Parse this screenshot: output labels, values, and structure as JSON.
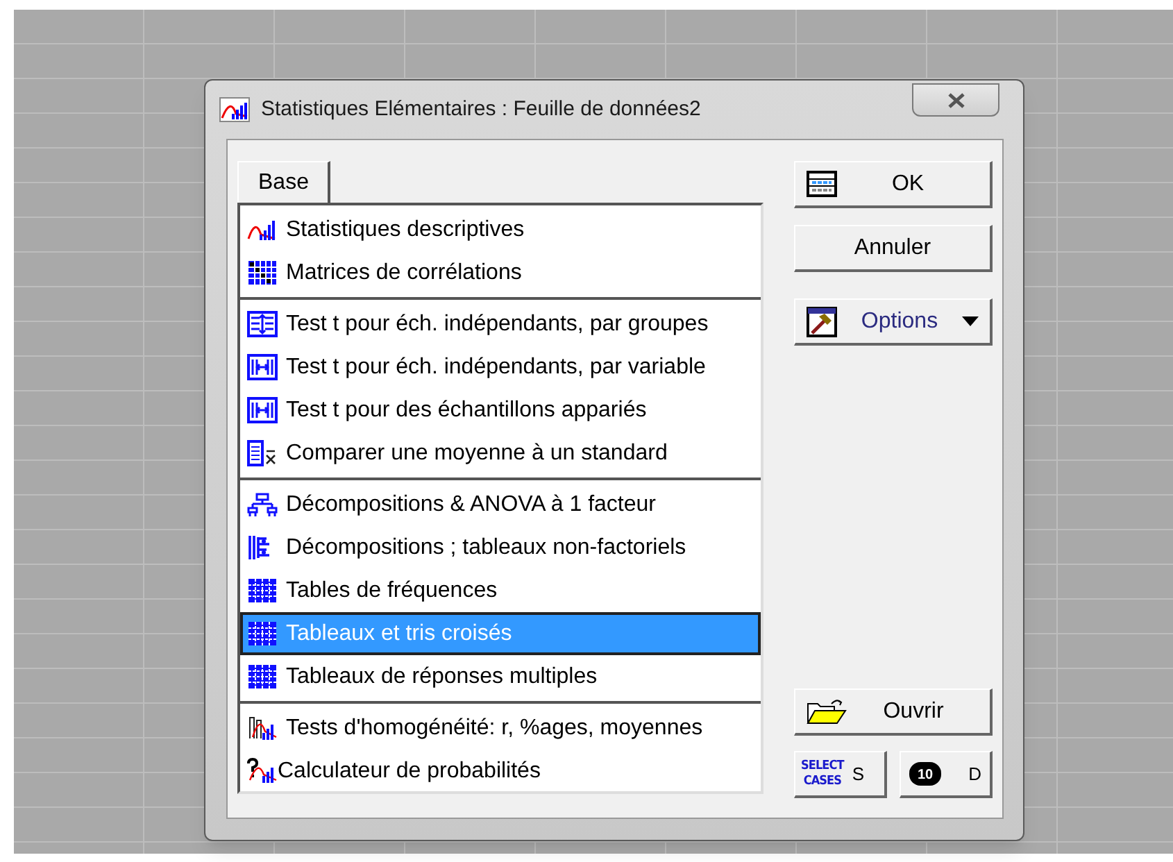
{
  "window": {
    "title": "Statistiques Elémentaires : Feuille de données2"
  },
  "tabs": [
    {
      "label": "Base",
      "selected": true
    }
  ],
  "list": {
    "groups": [
      {
        "items": [
          {
            "label": "Statistiques descriptives",
            "kind": "curve",
            "selected": false
          },
          {
            "label": "Matrices de corrélations",
            "kind": "matrix",
            "selected": false
          }
        ]
      },
      {
        "items": [
          {
            "label": "Test t pour éch. indépendants, par groupes",
            "kind": "updown",
            "selected": false
          },
          {
            "label": "Test t pour éch. indépendants, par variable",
            "kind": "leftright",
            "selected": false
          },
          {
            "label": "Test t pour des échantillons appariés",
            "kind": "leftright",
            "selected": false
          },
          {
            "label": "Comparer une moyenne à un standard",
            "kind": "xbar",
            "selected": false
          }
        ]
      },
      {
        "items": [
          {
            "label": "Décompositions & ANOVA à 1 facteur",
            "kind": "tree",
            "selected": false
          },
          {
            "label": "Décompositions ; tableaux non-factoriels",
            "kind": "branches",
            "selected": false
          },
          {
            "label": "Tables de fréquences",
            "kind": "grid",
            "selected": false
          },
          {
            "label": "Tableaux et tris croisés",
            "kind": "grid",
            "selected": true
          },
          {
            "label": "Tableaux de réponses multiples",
            "kind": "grid",
            "selected": false
          }
        ]
      },
      {
        "items": [
          {
            "label": "Tests d'homogénéité: r, %ages, moyennes",
            "kind": "bars",
            "selected": false
          },
          {
            "label": "Calculateur de probabilités",
            "kind": "question",
            "selected": false
          }
        ]
      }
    ]
  },
  "buttons": {
    "ok": {
      "label": "OK"
    },
    "cancel": {
      "label": "Annuler"
    },
    "options": {
      "label": "Options"
    },
    "open": {
      "label": "Ouvrir"
    },
    "select_cases": {
      "icon_text": [
        "SELECT",
        "CASES"
      ],
      "label": "S"
    },
    "weight": {
      "icon_text": "10",
      "label": "D"
    }
  }
}
